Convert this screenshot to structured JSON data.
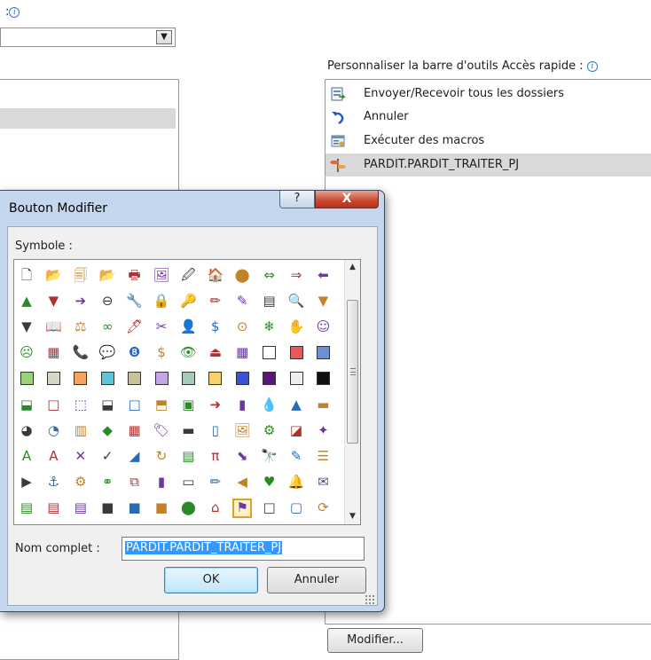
{
  "background": {
    "top_label": ":",
    "qat_label": "Personnaliser la barre d'outils Accès rapide :",
    "qat_items": [
      {
        "label": "Envoyer/Recevoir tous les dossiers",
        "icon": "send-receive-icon"
      },
      {
        "label": "Annuler",
        "icon": "undo-icon"
      },
      {
        "label": "Exécuter des macros",
        "icon": "run-macros-icon"
      },
      {
        "label": "PARDIT.PARDIT_TRAITER_PJ",
        "icon": "signpost-icon",
        "selected": true
      }
    ],
    "modifier_label": "Modifier..."
  },
  "dialog": {
    "title": "Bouton Modifier",
    "help_label": "?",
    "close_label": "X",
    "symbol_label": "Symbole :",
    "name_label": "Nom complet :",
    "name_value": "PARDIT.PARDIT_TRAITER_PJ",
    "ok_label": "OK",
    "cancel_label": "Annuler",
    "symbol_rows": [
      [
        "🗋",
        "📂",
        "🗐",
        "📂",
        "🖶",
        "🖼",
        "🖉",
        "🏠",
        "⬤",
        "⇔",
        "⇒",
        "⬅"
      ],
      [
        "▲",
        "▼",
        "➔",
        "⊖",
        "🔧",
        "🔒",
        "🔑",
        "✏",
        "✎",
        "▤",
        "🔍",
        "▼"
      ],
      [
        "▼",
        "📖",
        "⚖",
        "∞",
        "🖊",
        "✂",
        "👤",
        "$",
        "⊙",
        "❄",
        "✋",
        "☺"
      ],
      [
        "☹",
        "▦",
        "📞",
        "💬",
        "❽",
        "$",
        "👁",
        "⏏",
        "▦",
        "□",
        "■",
        "■"
      ],
      [
        "■",
        "■",
        "■",
        "■",
        "■",
        "■",
        "■",
        "■",
        "■",
        "■",
        "◩",
        "■"
      ],
      [
        "⬓",
        "□",
        "⬚",
        "⬓",
        "□",
        "⬒",
        "▣",
        "➜",
        "▮",
        "💧",
        "▲",
        "▬"
      ],
      [
        "◕",
        "◔",
        "▥",
        "◆",
        "▦",
        "🏷",
        "▬",
        "▯",
        "🖼",
        "⚙",
        "◪",
        "✦"
      ],
      [
        "A",
        "A",
        "✕",
        "✓",
        "◢",
        "↻",
        "▤",
        "π",
        "⬊",
        "🔭",
        "✎",
        "☰"
      ],
      [
        "▶",
        "⚓",
        "⚙",
        "⚭",
        "⧉",
        "▮",
        "▭",
        "✏",
        "◀",
        "♥",
        "🔔",
        "✉"
      ],
      [
        "▤",
        "▤",
        "▤",
        "■",
        "■",
        "■",
        "⬤",
        "⌂",
        "⚑",
        "□",
        "▢",
        "⟳"
      ]
    ],
    "swatch_colors": [
      "#9ad27c",
      "#d6d6c8",
      "#f5a35c",
      "#5cc6d6",
      "#c9c39a",
      "#c2a6e6",
      "#a6c9b8",
      "#f6d36a",
      "#3b52d6",
      "#5a167a",
      "#eeeeee",
      "#111111"
    ]
  }
}
